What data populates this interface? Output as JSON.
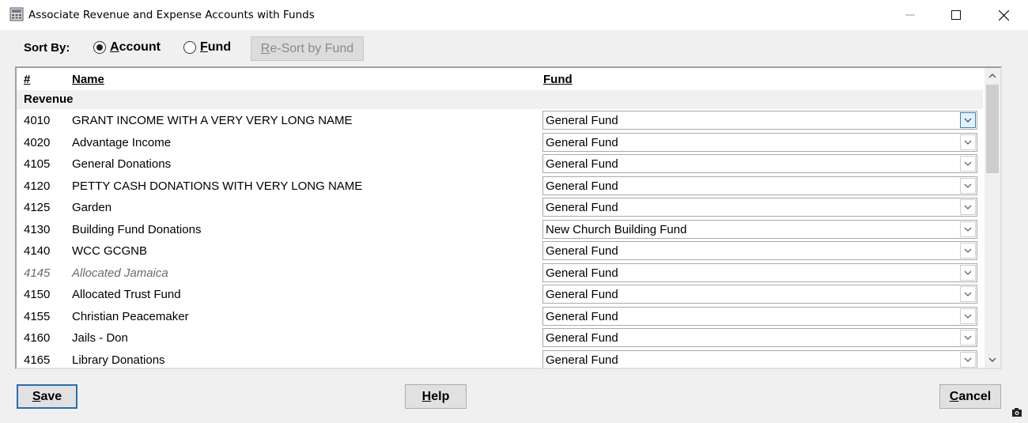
{
  "window": {
    "title": "Associate Revenue and Expense Accounts with Funds",
    "icon": "ledger-calculator-icon"
  },
  "sort_bar": {
    "label": "Sort By:",
    "options": [
      {
        "mnemonic": "A",
        "rest": "ccount",
        "selected": true
      },
      {
        "mnemonic": "F",
        "rest": "und",
        "selected": false
      }
    ],
    "resort_button": {
      "mnemonic": "R",
      "rest": "e-Sort by Fund",
      "enabled": false
    }
  },
  "grid": {
    "columns": {
      "number": "#",
      "name": "Name",
      "fund": "Fund"
    },
    "group": "Revenue",
    "rows": [
      {
        "number": "4010",
        "name": "GRANT INCOME WITH A VERY VERY LONG NAME",
        "fund": "General Fund",
        "inactive": false,
        "focused": true
      },
      {
        "number": "4020",
        "name": "Advantage Income",
        "fund": "General Fund",
        "inactive": false,
        "focused": false
      },
      {
        "number": "4105",
        "name": "General Donations",
        "fund": "General Fund",
        "inactive": false,
        "focused": false
      },
      {
        "number": "4120",
        "name": "PETTY CASH DONATIONS WITH VERY LONG NAME",
        "fund": "General Fund",
        "inactive": false,
        "focused": false
      },
      {
        "number": "4125",
        "name": "Garden",
        "fund": "General Fund",
        "inactive": false,
        "focused": false
      },
      {
        "number": "4130",
        "name": "Building Fund Donations",
        "fund": "New Church Building Fund",
        "inactive": false,
        "focused": false
      },
      {
        "number": "4140",
        "name": "WCC GCGNB",
        "fund": "General Fund",
        "inactive": false,
        "focused": false
      },
      {
        "number": "4145",
        "name": "Allocated Jamaica",
        "fund": "General Fund",
        "inactive": true,
        "focused": false
      },
      {
        "number": "4150",
        "name": "Allocated Trust Fund",
        "fund": "General Fund",
        "inactive": false,
        "focused": false
      },
      {
        "number": "4155",
        "name": "Christian Peacemaker",
        "fund": "General Fund",
        "inactive": false,
        "focused": false
      },
      {
        "number": "4160",
        "name": "Jails - Don",
        "fund": "General Fund",
        "inactive": false,
        "focused": false
      },
      {
        "number": "4165",
        "name": "Library Donations",
        "fund": "General Fund",
        "inactive": false,
        "focused": false
      }
    ]
  },
  "buttons": {
    "save": {
      "mnemonic": "S",
      "rest": "ave"
    },
    "help": {
      "mnemonic": "H",
      "rest": "elp"
    },
    "cancel": {
      "mnemonic": "C",
      "rest": "ancel"
    }
  },
  "colors": {
    "dialog_bg": "#f0f0f0",
    "focus_border": "#2a6db0",
    "disabled_text": "#8a8a8a",
    "inactive_text": "#6a6a6a"
  }
}
